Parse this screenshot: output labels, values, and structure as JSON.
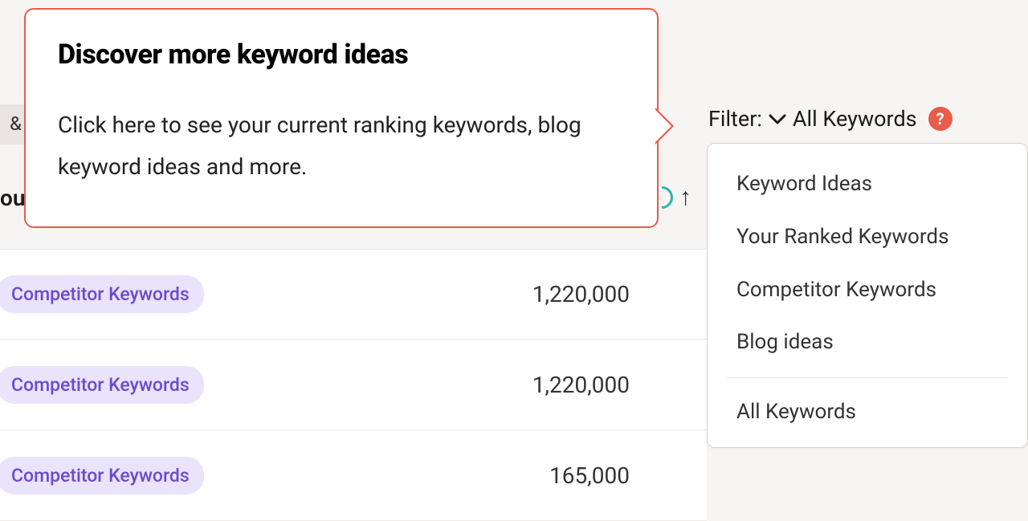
{
  "fragments": {
    "top_bar": "& S",
    "ou": "ou"
  },
  "callout": {
    "title": "Discover more keyword ideas",
    "body": "Click here to see your current ranking keywords, blog keyword ideas and more."
  },
  "sort_arrow": "↑",
  "filter": {
    "label": "Filter:",
    "current": "All Keywords",
    "options": [
      "Keyword Ideas",
      "Your Ranked Keywords",
      "Competitor Keywords",
      "Blog ideas"
    ],
    "all_option": "All Keywords"
  },
  "rows": [
    {
      "tag": "Competitor Keywords",
      "value": "1,220,000"
    },
    {
      "tag": "Competitor Keywords",
      "value": "1,220,000"
    },
    {
      "tag": "Competitor Keywords",
      "value": "165,000"
    }
  ],
  "help_glyph": "?"
}
